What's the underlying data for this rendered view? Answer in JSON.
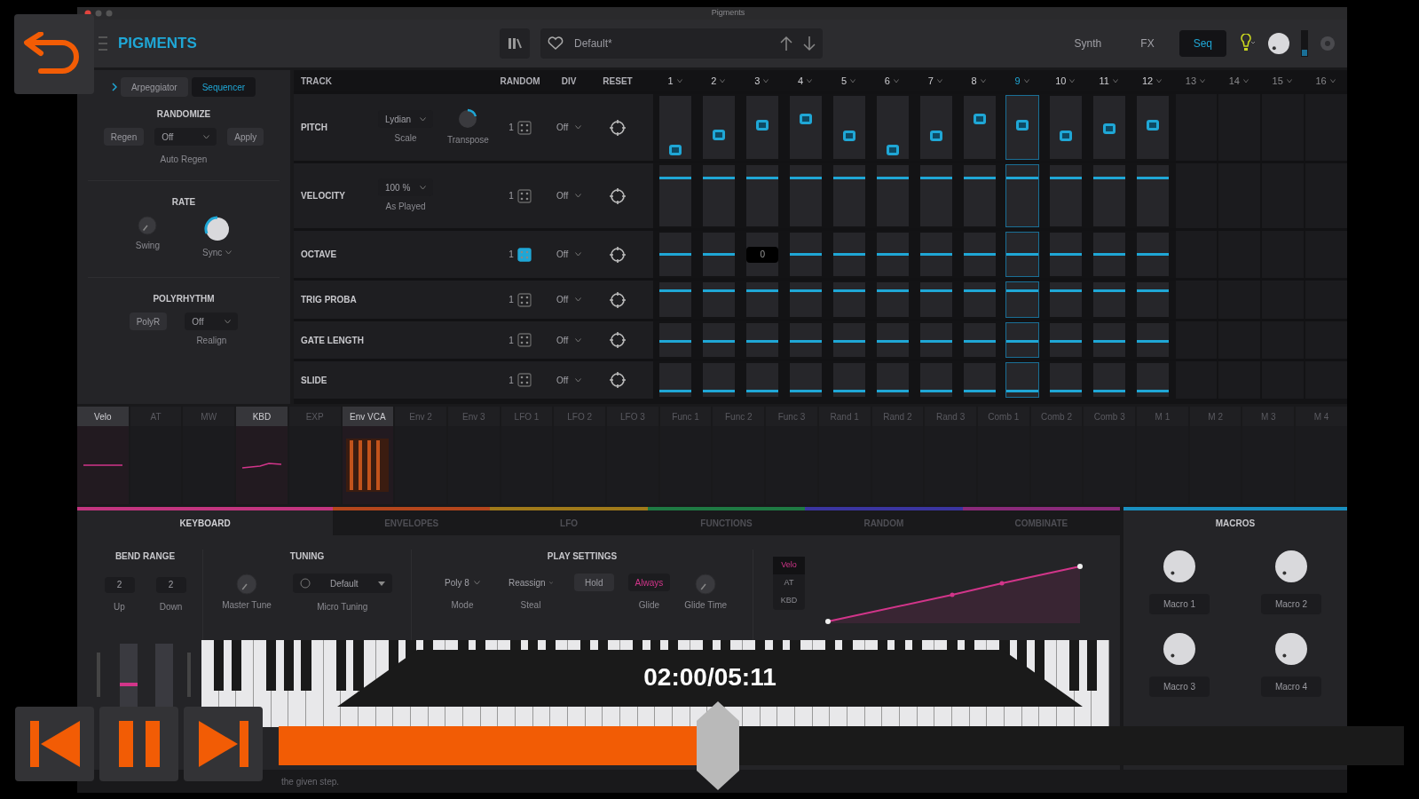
{
  "window": {
    "title": "Pigments"
  },
  "toolbar": {
    "logo": "PIGMENTS",
    "preset": "Default*",
    "views": [
      {
        "label": "Synth",
        "selected": false
      },
      {
        "label": "FX",
        "selected": false
      },
      {
        "label": "Seq",
        "selected": true
      }
    ]
  },
  "seq_panel": {
    "tabs": [
      {
        "label": "Arpeggiator",
        "selected": false
      },
      {
        "label": "Sequencer",
        "selected": true
      }
    ],
    "randomize": {
      "title": "RANDOMIZE",
      "regen": "Regen",
      "mode": "Off",
      "apply": "Apply",
      "caption": "Auto Regen"
    },
    "rate": {
      "title": "RATE",
      "swing": "Swing",
      "sync": "Sync"
    },
    "polyrhythm": {
      "title": "POLYRHYTHM",
      "button": "PolyR",
      "value": "Off",
      "caption": "Realign"
    }
  },
  "sequencer": {
    "columns": [
      "TRACK",
      "RANDOM",
      "DIV",
      "RESET"
    ],
    "steps": [
      {
        "label": "1",
        "on": true,
        "selected": false
      },
      {
        "label": "2",
        "on": true,
        "selected": false
      },
      {
        "label": "3",
        "on": true,
        "selected": false
      },
      {
        "label": "4",
        "on": true,
        "selected": false
      },
      {
        "label": "5",
        "on": true,
        "selected": false
      },
      {
        "label": "6",
        "on": true,
        "selected": false
      },
      {
        "label": "7",
        "on": true,
        "selected": false
      },
      {
        "label": "8",
        "on": true,
        "selected": false
      },
      {
        "label": "9",
        "on": true,
        "selected": true
      },
      {
        "label": "10",
        "on": true,
        "selected": false
      },
      {
        "label": "11",
        "on": true,
        "selected": false
      },
      {
        "label": "12",
        "on": true,
        "selected": false
      },
      {
        "label": "13",
        "on": false,
        "selected": false
      },
      {
        "label": "14",
        "on": false,
        "selected": false
      },
      {
        "label": "15",
        "on": false,
        "selected": false
      },
      {
        "label": "16",
        "on": false,
        "selected": false
      }
    ],
    "rows": [
      {
        "name": "PITCH",
        "kind": "pitch",
        "extra": {
          "value": "Lydian",
          "caption": "Scale",
          "knob_caption": "Transpose"
        },
        "random": "1",
        "random_on": false,
        "div": "Off",
        "cells": [
          {
            "level": 0.23
          },
          {
            "level": 0.46
          },
          {
            "level": 0.62
          },
          {
            "level": 0.72
          },
          {
            "level": 0.45
          },
          {
            "level": 0.23
          },
          {
            "level": 0.45
          },
          {
            "level": 0.72
          },
          {
            "level": 0.62
          },
          {
            "level": 0.45
          },
          {
            "level": 0.56
          },
          {
            "level": 0.62
          }
        ]
      },
      {
        "name": "VELOCITY",
        "kind": "line",
        "extra": {
          "value": "100 %",
          "caption": "As Played"
        },
        "random": "1",
        "random_on": false,
        "div": "Off",
        "level": 0.78
      },
      {
        "name": "OCTAVE",
        "kind": "line",
        "random": "1",
        "random_on": true,
        "div": "Off",
        "cells": [
          {
            "level": 0.5
          },
          {
            "level": 0.5
          },
          {
            "level": 0.5,
            "tooltip": "0"
          },
          {
            "level": 0.5
          },
          {
            "level": 0.5
          },
          {
            "level": 0.5
          },
          {
            "level": 0.5
          },
          {
            "level": 0.5
          },
          {
            "level": 0.5
          },
          {
            "level": 0.5
          },
          {
            "level": 0.5
          },
          {
            "level": 0.5
          }
        ]
      },
      {
        "name": "TRIG PROBA",
        "kind": "line",
        "random": "1",
        "random_on": false,
        "div": "Off",
        "level": 0.75
      },
      {
        "name": "GATE LENGTH",
        "kind": "line",
        "random": "1",
        "random_on": false,
        "div": "Off",
        "level": 0.45
      },
      {
        "name": "SLIDE",
        "kind": "line",
        "random": "1",
        "random_on": false,
        "div": "Off",
        "level": 0.15
      }
    ]
  },
  "mod_sources": [
    {
      "label": "Velo",
      "selected": true,
      "kind": "flat"
    },
    {
      "label": "AT",
      "selected": false
    },
    {
      "label": "MW",
      "selected": false
    },
    {
      "label": "KBD",
      "selected": true,
      "kind": "ramp"
    },
    {
      "label": "EXP",
      "selected": false
    },
    {
      "label": "Env VCA",
      "selected": true,
      "kind": "bars"
    },
    {
      "label": "Env 2",
      "selected": false
    },
    {
      "label": "Env 3",
      "selected": false
    },
    {
      "label": "LFO 1",
      "selected": false
    },
    {
      "label": "LFO 2",
      "selected": false
    },
    {
      "label": "LFO 3",
      "selected": false
    },
    {
      "label": "Func 1",
      "selected": false
    },
    {
      "label": "Func 2",
      "selected": false
    },
    {
      "label": "Func 3",
      "selected": false
    },
    {
      "label": "Rand 1",
      "selected": false
    },
    {
      "label": "Rand 2",
      "selected": false
    },
    {
      "label": "Rand 3",
      "selected": false
    },
    {
      "label": "Comb 1",
      "selected": false
    },
    {
      "label": "Comb 2",
      "selected": false
    },
    {
      "label": "Comb 3",
      "selected": false
    },
    {
      "label": "M 1",
      "selected": false
    },
    {
      "label": "M 2",
      "selected": false
    },
    {
      "label": "M 3",
      "selected": false
    },
    {
      "label": "M 4",
      "selected": false
    }
  ],
  "mod_tabs": [
    {
      "label": "KEYBOARD",
      "selected": true,
      "color": "#c2357f"
    },
    {
      "label": "ENVELOPES",
      "selected": false,
      "color": "#b4461c"
    },
    {
      "label": "LFO",
      "selected": false,
      "color": "#a07a1a"
    },
    {
      "label": "FUNCTIONS",
      "selected": false,
      "color": "#1f7a43"
    },
    {
      "label": "RANDOM",
      "selected": false,
      "color": "#3b35a0"
    },
    {
      "label": "COMBINATE",
      "selected": false,
      "color": "#8a2a7a"
    }
  ],
  "keyboard_panel": {
    "bend": {
      "title": "BEND RANGE",
      "up": "2",
      "up_caption": "Up",
      "down": "2",
      "down_caption": "Down"
    },
    "tuning": {
      "title": "TUNING",
      "master_caption": "Master Tune",
      "micro": "Default",
      "micro_caption": "Micro Tuning"
    },
    "play": {
      "title": "PLAY SETTINGS",
      "mode": "Poly 8",
      "mode_caption": "Mode",
      "steal": "Reassign",
      "steal_caption": "Steal",
      "hold": "Hold",
      "glide": "Always",
      "glide_caption": "Glide",
      "glide_time_caption": "Glide Time"
    },
    "curve_sources": [
      {
        "label": "Velo",
        "selected": true
      },
      {
        "label": "AT",
        "selected": false
      },
      {
        "label": "KBD",
        "selected": false
      }
    ]
  },
  "macros": {
    "title": "MACROS",
    "items": [
      "Macro 1",
      "Macro 2",
      "Macro 3",
      "Macro 4"
    ]
  },
  "status": {
    "text": "the given step."
  },
  "player": {
    "time": "02:00/05:11",
    "level": 0.39,
    "playing": true
  }
}
